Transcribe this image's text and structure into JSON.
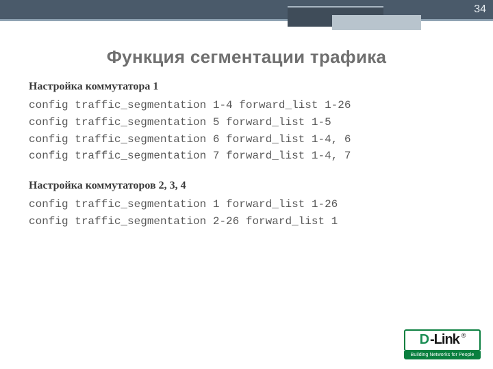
{
  "page_number": "34",
  "title": "Функция сегментации трафика",
  "section1": {
    "heading": "Настройка коммутатора 1",
    "lines": [
      "config traffic_segmentation 1-4 forward_list 1-26",
      "config traffic_segmentation 5 forward_list 1-5",
      "config traffic_segmentation 6 forward_list 1-4, 6",
      "config traffic_segmentation 7 forward_list 1-4, 7"
    ]
  },
  "section2": {
    "heading": "Настройка коммутаторов 2, 3, 4",
    "lines": [
      "config traffic_segmentation 1 forward_list 1-26",
      "config traffic_segmentation 2-26 forward_list 1"
    ]
  },
  "logo": {
    "brand_prefix": "D",
    "brand_suffix": "-Link",
    "registered": "®",
    "tagline": "Building Networks for People"
  }
}
